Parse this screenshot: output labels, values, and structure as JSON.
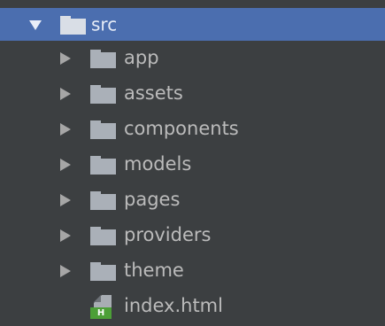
{
  "tree": {
    "root": {
      "label": "src",
      "expanded": true,
      "selected": true,
      "icon": "folder-icon"
    },
    "children": [
      {
        "label": "app",
        "type": "folder",
        "icon": "folder-icon"
      },
      {
        "label": "assets",
        "type": "folder",
        "icon": "folder-icon"
      },
      {
        "label": "components",
        "type": "folder",
        "icon": "folder-icon"
      },
      {
        "label": "models",
        "type": "folder",
        "icon": "folder-icon"
      },
      {
        "label": "pages",
        "type": "folder",
        "icon": "folder-icon"
      },
      {
        "label": "providers",
        "type": "folder",
        "icon": "folder-icon"
      },
      {
        "label": "theme",
        "type": "folder",
        "icon": "folder-icon"
      },
      {
        "label": "index.html",
        "type": "file",
        "icon": "html-file-icon",
        "badge": "H"
      }
    ]
  },
  "colors": {
    "background": "#3c3f41",
    "selection": "#4b6eaf",
    "text": "#bbbbbb",
    "folder": "#aab0b8",
    "html_badge": "#4c9f37"
  }
}
